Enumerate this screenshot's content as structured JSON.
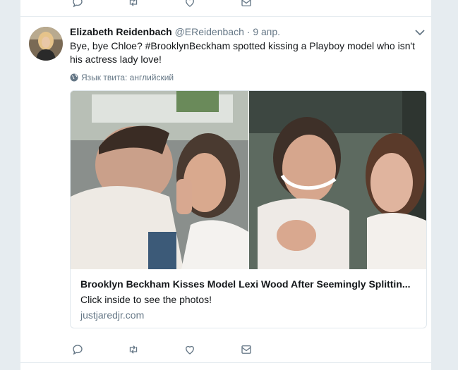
{
  "tweet": {
    "fullname": "Elizabeth Reidenbach",
    "username": "@EReidenbach",
    "dot": "·",
    "time": "9 апр.",
    "text_part1": "Bye, bye Chloe? ",
    "hashtag": "#BrooklynBeckham",
    "text_part2": " spotted kissing a Playboy model who isn't his actress lady love!",
    "language_label": "Язык твита: английский"
  },
  "card": {
    "title": "Brooklyn Beckham Kisses Model Lexi Wood After Seemingly Splittin...",
    "description": "Click inside to see the photos!",
    "domain": "justjaredjr.com"
  },
  "icons": {
    "reply": "reply-icon",
    "retweet": "retweet-icon",
    "like": "heart-icon",
    "dm": "envelope-icon",
    "caret": "chevron-down-icon",
    "globe": "globe-icon"
  },
  "colors": {
    "background": "#e6ecf0",
    "text": "#14171a",
    "muted": "#657786",
    "icon": "#657786"
  }
}
